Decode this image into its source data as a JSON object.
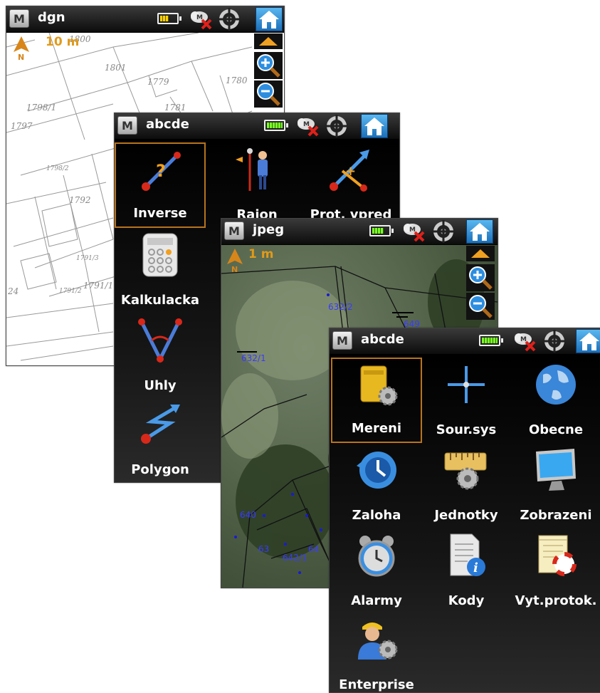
{
  "screens": {
    "dgn": {
      "title": "dgn",
      "scale": "10 m",
      "parcels": [
        "1800",
        "1801",
        "1779",
        "1780",
        "1798/1",
        "1781",
        "1798/2",
        "1792",
        "1797",
        "1791/3",
        "1791/2",
        "1791/1",
        "24"
      ],
      "icons": {
        "menu": "m-logo-icon",
        "battery": "battery-half-icon",
        "cloud": "cloud-disconnected-icon",
        "gps": "gps-target-icon",
        "home": "home-icon"
      }
    },
    "menu1": {
      "title": "abcde",
      "items": [
        {
          "label": "Inverse",
          "icon": "inverse-line-icon"
        },
        {
          "label": "Rajon",
          "icon": "surveyor-rajon-icon"
        },
        {
          "label": "Prot. vpred",
          "icon": "forward-intersection-icon"
        },
        {
          "label": "Kalkulacka",
          "icon": "calculator-icon"
        },
        {
          "label": "Uhly",
          "icon": "angles-icon"
        },
        {
          "label": "Polygon",
          "icon": "polygon-traverse-icon"
        }
      ]
    },
    "jpeg": {
      "title": "jpeg",
      "scale": "1 m",
      "parcels": [
        "632/2",
        "649",
        "632/1",
        "640",
        "63",
        "642/1",
        "64"
      ]
    },
    "menu2": {
      "title": "abcde",
      "items": [
        {
          "label": "Mereni",
          "icon": "folder-gear-icon"
        },
        {
          "label": "Sour.sys",
          "icon": "compass-icon"
        },
        {
          "label": "Obecne",
          "icon": "globe-icon"
        },
        {
          "label": "Zaloha",
          "icon": "backup-clock-icon"
        },
        {
          "label": "Jednotky",
          "icon": "ruler-gear-icon"
        },
        {
          "label": "Zobrazeni",
          "icon": "monitor-icon"
        },
        {
          "label": "Alarmy",
          "icon": "alarm-clock-icon"
        },
        {
          "label": "Kody",
          "icon": "document-info-icon"
        },
        {
          "label": "Vyt.protok.",
          "icon": "notepad-icon"
        },
        {
          "label": "Enterprise",
          "icon": "user-gear-icon"
        }
      ]
    }
  },
  "colors": {
    "accent": "#b8731d",
    "scale_text": "#e09a1a",
    "home": "#1b6fb8",
    "battery_full": "#7cff2a",
    "battery_half": "#ffd400"
  }
}
